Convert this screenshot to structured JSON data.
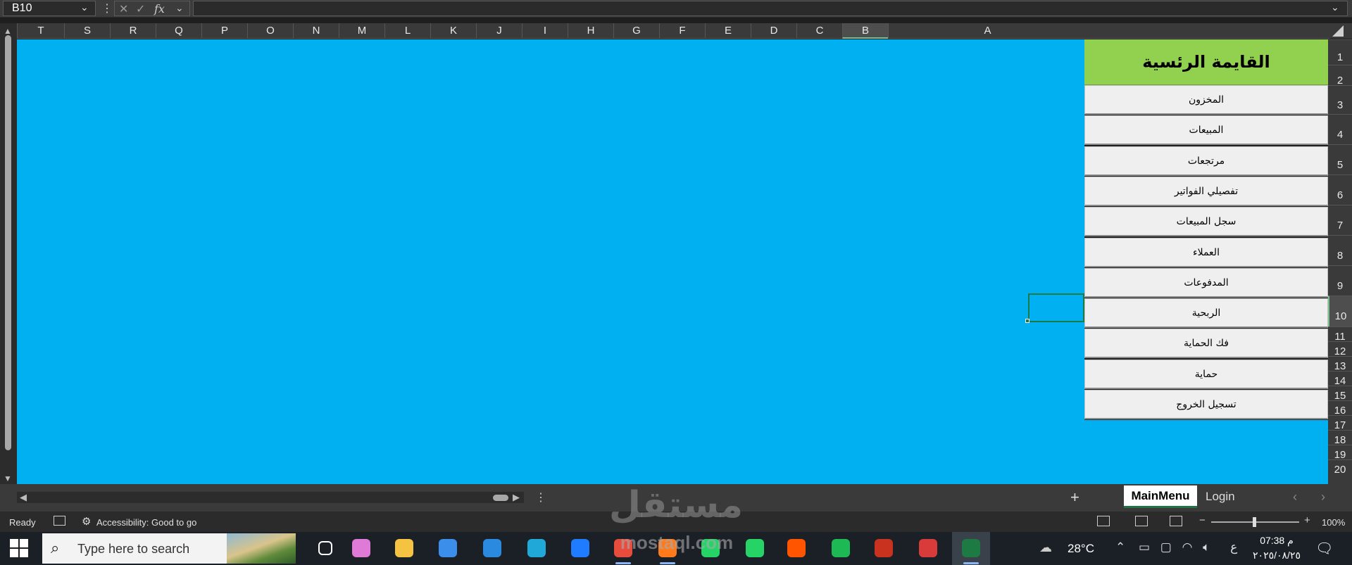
{
  "formula_bar": {
    "name_box": "B10",
    "fx_label": "fx",
    "cancel_glyph": "✕",
    "enter_glyph": "✓",
    "formula_value": ""
  },
  "grid": {
    "columns": [
      "T",
      "S",
      "R",
      "Q",
      "P",
      "O",
      "N",
      "M",
      "L",
      "K",
      "J",
      "I",
      "H",
      "G",
      "F",
      "E",
      "D",
      "C",
      "B",
      "A"
    ],
    "rows": [
      "1",
      "2",
      "3",
      "4",
      "5",
      "6",
      "7",
      "8",
      "9",
      "10",
      "11",
      "12",
      "13",
      "14",
      "15",
      "16",
      "17",
      "18",
      "19",
      "20"
    ],
    "selected_column": "B",
    "selected_row": "10",
    "background_color": "#00b0f0"
  },
  "menu": {
    "title": "القايمة الرئسية",
    "title_color": "#92d050",
    "items": [
      "المخزون",
      "المبيعات",
      "مرتجعات",
      "تفصيلي الفواتير",
      "سجل المبيعات",
      "العملاء",
      "المدفوعات",
      "الربحية",
      "فك الحماية",
      "حماية",
      "تسجيل الخروج"
    ]
  },
  "sheet_tabs": {
    "active": "MainMenu",
    "other": "Login",
    "add_glyph": "+"
  },
  "status_bar": {
    "ready": "Ready",
    "accessibility": "Accessibility: Good to go",
    "zoom": "100%",
    "zoom_minus": "−",
    "zoom_plus": "+"
  },
  "taskbar": {
    "search_placeholder": "Type here to search",
    "temperature": "28°C",
    "clock_time": "07:38 م",
    "clock_date": "٢٠٢٥/٠٨/٢٥",
    "input_lang": "ع",
    "apps": [
      {
        "icon": "task-view-icon",
        "color": "#ffffff"
      },
      {
        "icon": "copilot-icon",
        "color": "#e07ad8"
      },
      {
        "icon": "file-explorer-icon",
        "color": "#f5c242"
      },
      {
        "icon": "microsoft-store-icon",
        "color": "#3b8eea"
      },
      {
        "icon": "mail-icon",
        "color": "#2a8ae0"
      },
      {
        "icon": "edge-icon",
        "color": "#1fa8d8"
      },
      {
        "icon": "messenger-icon",
        "color": "#1f7cff"
      },
      {
        "icon": "chrome-icon",
        "color": "#e84c3d"
      },
      {
        "icon": "firefox-icon",
        "color": "#ff7a1a"
      },
      {
        "icon": "whatsapp-icon",
        "color": "#25d366"
      },
      {
        "icon": "whatsapp-icon",
        "color": "#25d366"
      },
      {
        "icon": "soundcloud-icon",
        "color": "#ff5500"
      },
      {
        "icon": "spotify-icon",
        "color": "#1db954"
      },
      {
        "icon": "game-icon",
        "color": "#c8321e"
      },
      {
        "icon": "snipping-tool-icon",
        "color": "#d93a3a"
      },
      {
        "icon": "excel-icon",
        "color": "#1d7a43"
      }
    ]
  },
  "watermark": {
    "logo": "مستقل",
    "url": "mostaql.com"
  }
}
